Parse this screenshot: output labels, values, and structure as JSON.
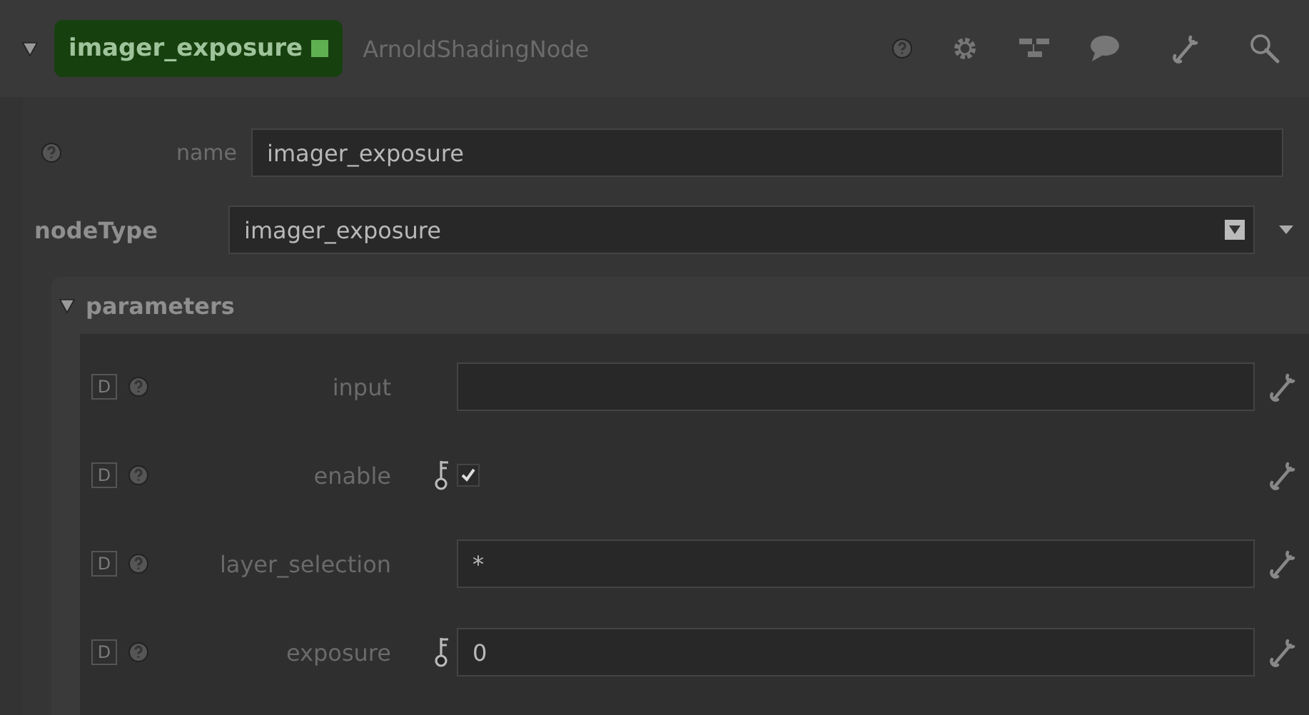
{
  "header": {
    "expanded": true,
    "node_name": "imager_exposure",
    "node_class": "ArnoldShadingNode"
  },
  "name_field": {
    "label": "name",
    "value": "imager_exposure"
  },
  "node_type": {
    "label": "nodeType",
    "value": "imager_exposure"
  },
  "parameters": {
    "title": "parameters",
    "expanded": true,
    "items": [
      {
        "kind": "text",
        "badge": "D",
        "label": "input",
        "keyable": false,
        "value": ""
      },
      {
        "kind": "checkbox",
        "badge": "D",
        "label": "enable",
        "keyable": true,
        "checked": true
      },
      {
        "kind": "text",
        "badge": "D",
        "label": "layer_selection",
        "keyable": false,
        "value": "*"
      },
      {
        "kind": "text",
        "badge": "D",
        "label": "exposure",
        "keyable": true,
        "value": "0"
      }
    ]
  }
}
